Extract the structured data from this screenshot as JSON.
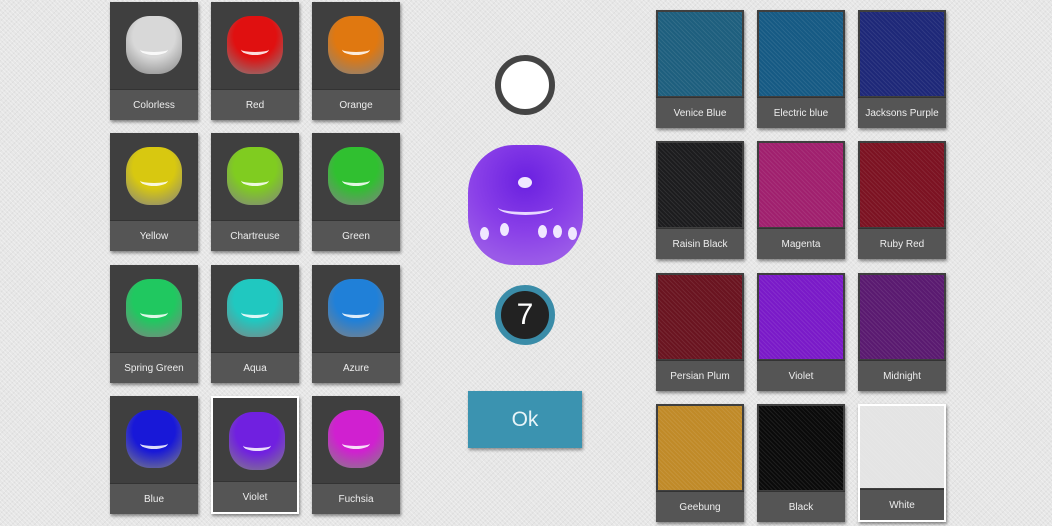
{
  "dice_colors": [
    {
      "label": "Colorless",
      "color": "#d8d8d8"
    },
    {
      "label": "Red",
      "color": "#e01010"
    },
    {
      "label": "Orange",
      "color": "#e07810"
    },
    {
      "label": "Yellow",
      "color": "#d8c810"
    },
    {
      "label": "Chartreuse",
      "color": "#80cc20"
    },
    {
      "label": "Green",
      "color": "#30c030"
    },
    {
      "label": "Spring Green",
      "color": "#20c860"
    },
    {
      "label": "Aqua",
      "color": "#20c8c0"
    },
    {
      "label": "Azure",
      "color": "#2080d8"
    },
    {
      "label": "Blue",
      "color": "#1818d8"
    },
    {
      "label": "Violet",
      "color": "#7020e0",
      "selected": true
    },
    {
      "label": "Fuchsia",
      "color": "#d020d0"
    }
  ],
  "board_colors": [
    {
      "label": "Venice Blue",
      "color": "#1e5f7e"
    },
    {
      "label": "Electric blue",
      "color": "#165a84"
    },
    {
      "label": "Jacksons Purple",
      "color": "#1e2878"
    },
    {
      "label": "Raisin Black",
      "color": "#1c1c1e"
    },
    {
      "label": "Magenta",
      "color": "#a0206e"
    },
    {
      "label": "Ruby Red",
      "color": "#7c1222"
    },
    {
      "label": "Persian Plum",
      "color": "#6a1420"
    },
    {
      "label": "Violet",
      "color": "#7a1ac8"
    },
    {
      "label": "Midnight",
      "color": "#5a1a70"
    },
    {
      "label": "Geebung",
      "color": "#c08a28"
    },
    {
      "label": "Black",
      "color": "#0a0a0a"
    },
    {
      "label": "White",
      "color": "#e4e4e4",
      "selected": true
    }
  ],
  "preview": {
    "pip_color": "white",
    "count": "7",
    "ok_label": "Ok"
  }
}
